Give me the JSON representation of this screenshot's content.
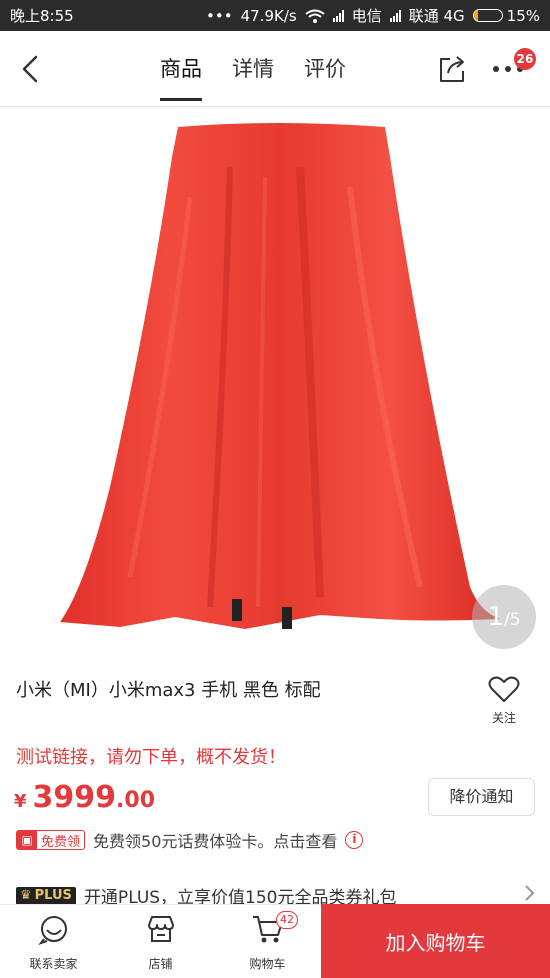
{
  "status_bar": {
    "time": "晚上8:55",
    "network_speed": "47.9K/s",
    "carrier1": "电信",
    "carrier2": "联通 4G",
    "battery": "15%"
  },
  "header": {
    "tabs": [
      {
        "label": "商品",
        "active": true
      },
      {
        "label": "详情",
        "active": false
      },
      {
        "label": "评价",
        "active": false
      }
    ],
    "more_badge": "26"
  },
  "gallery": {
    "current_page": "1",
    "total_pages": "/5"
  },
  "product": {
    "title": "小米（MI）小米max3 手机 黑色 标配",
    "favorite_label": "关注",
    "warning": "测试链接，请勿下单，概不发货！",
    "price_symbol": "¥",
    "price_int": "3999",
    "price_dec": ".00",
    "price_notify_label": "降价通知"
  },
  "coupon": {
    "tag_label": "免费领",
    "text": "免费领50元话费体验卡。点击查看"
  },
  "plus": {
    "badge": "PLUS",
    "text": "开通PLUS，立享价值150元全品类券礼包"
  },
  "bottom_bar": {
    "contact_label": "联系卖家",
    "store_label": "店铺",
    "cart_label": "购物车",
    "cart_count": "42",
    "add_to_cart_label": "加入购物车"
  },
  "colors": {
    "accent": "#e4393c",
    "status_bar_bg": "#2b2b2b"
  }
}
